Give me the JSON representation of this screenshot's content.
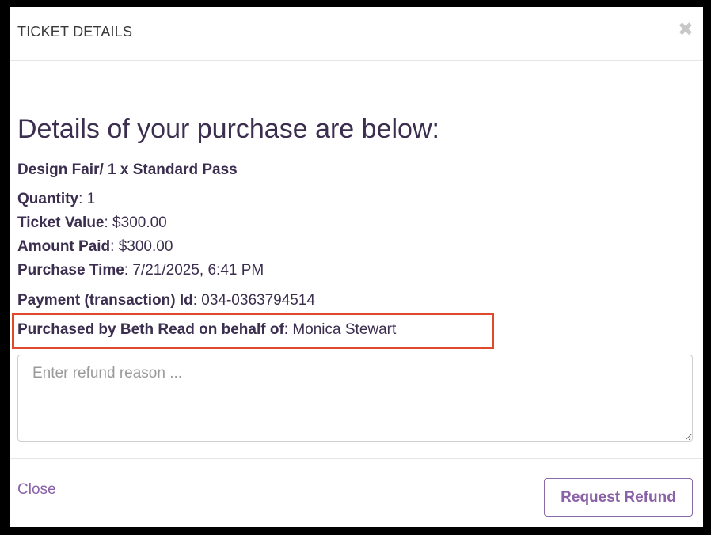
{
  "modal": {
    "title": "TICKET DETAILS",
    "close_icon": "close-icon",
    "close_glyph": "✖"
  },
  "purchase": {
    "heading": "Details of your purchase are below:",
    "product": "Design Fair/ 1 x Standard Pass",
    "quantity_label": "Quantity",
    "quantity_value": ": 1",
    "ticket_value_label": "Ticket Value",
    "ticket_value": ": $300.00",
    "amount_paid_label": "Amount Paid",
    "amount_paid": ": $300.00",
    "purchase_time_label": "Purchase Time",
    "purchase_time": ": 7/21/2025, 6:41 PM",
    "transaction_label": "Payment (transaction) Id",
    "transaction_id": ": 034-0363794514",
    "purchased_by_label": "Purchased by Beth Read on behalf of",
    "purchased_for": ": Monica Stewart"
  },
  "refund": {
    "placeholder": "Enter refund reason ...",
    "value": ""
  },
  "footer": {
    "close_label": "Close",
    "request_refund_label": "Request Refund"
  },
  "colors": {
    "highlight_border": "#e04a2c",
    "accent": "#8a62a8",
    "text": "#3b2e4f"
  }
}
